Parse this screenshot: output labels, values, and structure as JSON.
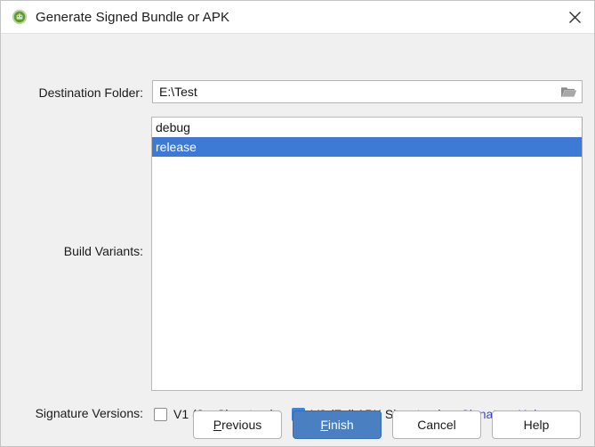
{
  "window": {
    "title": "Generate Signed Bundle or APK",
    "icon": "android-studio-icon",
    "close_icon": "close-icon"
  },
  "form": {
    "destination": {
      "label": "Destination Folder:",
      "value": "E:\\Test",
      "placeholder": "",
      "browse_icon": "folder-open-icon"
    },
    "build_variants": {
      "label": "Build Variants:",
      "items": [
        {
          "name": "debug",
          "selected": false
        },
        {
          "name": "release",
          "selected": true
        }
      ],
      "selected_value": "release"
    },
    "signature_versions": {
      "label": "Signature Versions:",
      "v1": {
        "pre": "V1 (",
        "mnemonic": "J",
        "post": "ar Signature)",
        "checked": false
      },
      "v2": {
        "pre": "V2 (Full ",
        "mnemonic": "A",
        "post": "PK Signature)",
        "checked": true
      },
      "help_link": "Signature Help"
    }
  },
  "footer": {
    "previous": {
      "pre": "",
      "mnemonic": "P",
      "post": "revious"
    },
    "finish": {
      "pre": "",
      "mnemonic": "F",
      "post": "inish"
    },
    "cancel": {
      "pre": "Cancel",
      "mnemonic": "",
      "post": ""
    },
    "help": {
      "pre": "Help",
      "mnemonic": "",
      "post": ""
    }
  },
  "colors": {
    "selection_blue": "#3c7ad6",
    "default_button_blue": "#4a7fc1",
    "link_blue": "#3a44c8",
    "dialog_bg": "#f0f0f0"
  }
}
